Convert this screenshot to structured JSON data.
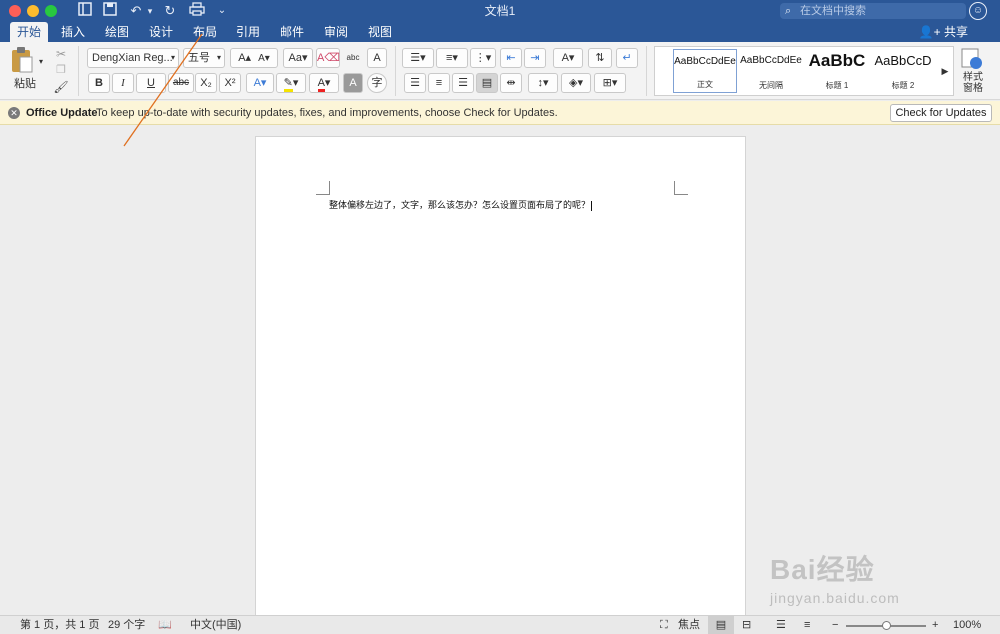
{
  "window": {
    "title": "文档1",
    "search_placeholder": "在文档中搜索",
    "share_label": "共享"
  },
  "tabs": [
    {
      "label": "开始",
      "active": true
    },
    {
      "label": "插入"
    },
    {
      "label": "绘图"
    },
    {
      "label": "设计"
    },
    {
      "label": "布局"
    },
    {
      "label": "引用"
    },
    {
      "label": "邮件"
    },
    {
      "label": "审阅"
    },
    {
      "label": "视图"
    }
  ],
  "ribbon": {
    "paste_label": "粘贴",
    "font_name": "DengXian Reg...",
    "font_size": "五号",
    "bold": "B",
    "italic": "I",
    "underline": "U",
    "strike": "abc",
    "subscript": "X₂",
    "superscript": "X²",
    "styles": [
      {
        "preview": "AaBbCcDdEe",
        "name": "正文",
        "selected": true
      },
      {
        "preview": "AaBbCcDdEe",
        "name": "无间隔"
      },
      {
        "preview": "AaBbC",
        "name": "标题 1"
      },
      {
        "preview": "AaBbCcD",
        "name": "标题 2"
      }
    ],
    "styles_pane_label": "样式\n窗格"
  },
  "message_bar": {
    "title": "Office Update",
    "text": "To keep up-to-date with security updates, fixes, and improvements, choose Check for Updates.",
    "button": "Check for Updates"
  },
  "document": {
    "text": "整体偏移左边了，文字，那么该怎办？怎么设置页面布局了的呢？"
  },
  "status_bar": {
    "page": "第 1 页，共 1 页",
    "words": "29 个字",
    "language": "中文(中国)",
    "focus": "焦点",
    "zoom": "100%",
    "zoom_fraction": 0.5
  },
  "watermark": {
    "logo": "Bai经验",
    "url": "jingyan.baidu.com"
  },
  "colors": {
    "title_bar": "#2b5797",
    "message_bar": "#fcf5d8",
    "annotation_line": "#e07020"
  }
}
